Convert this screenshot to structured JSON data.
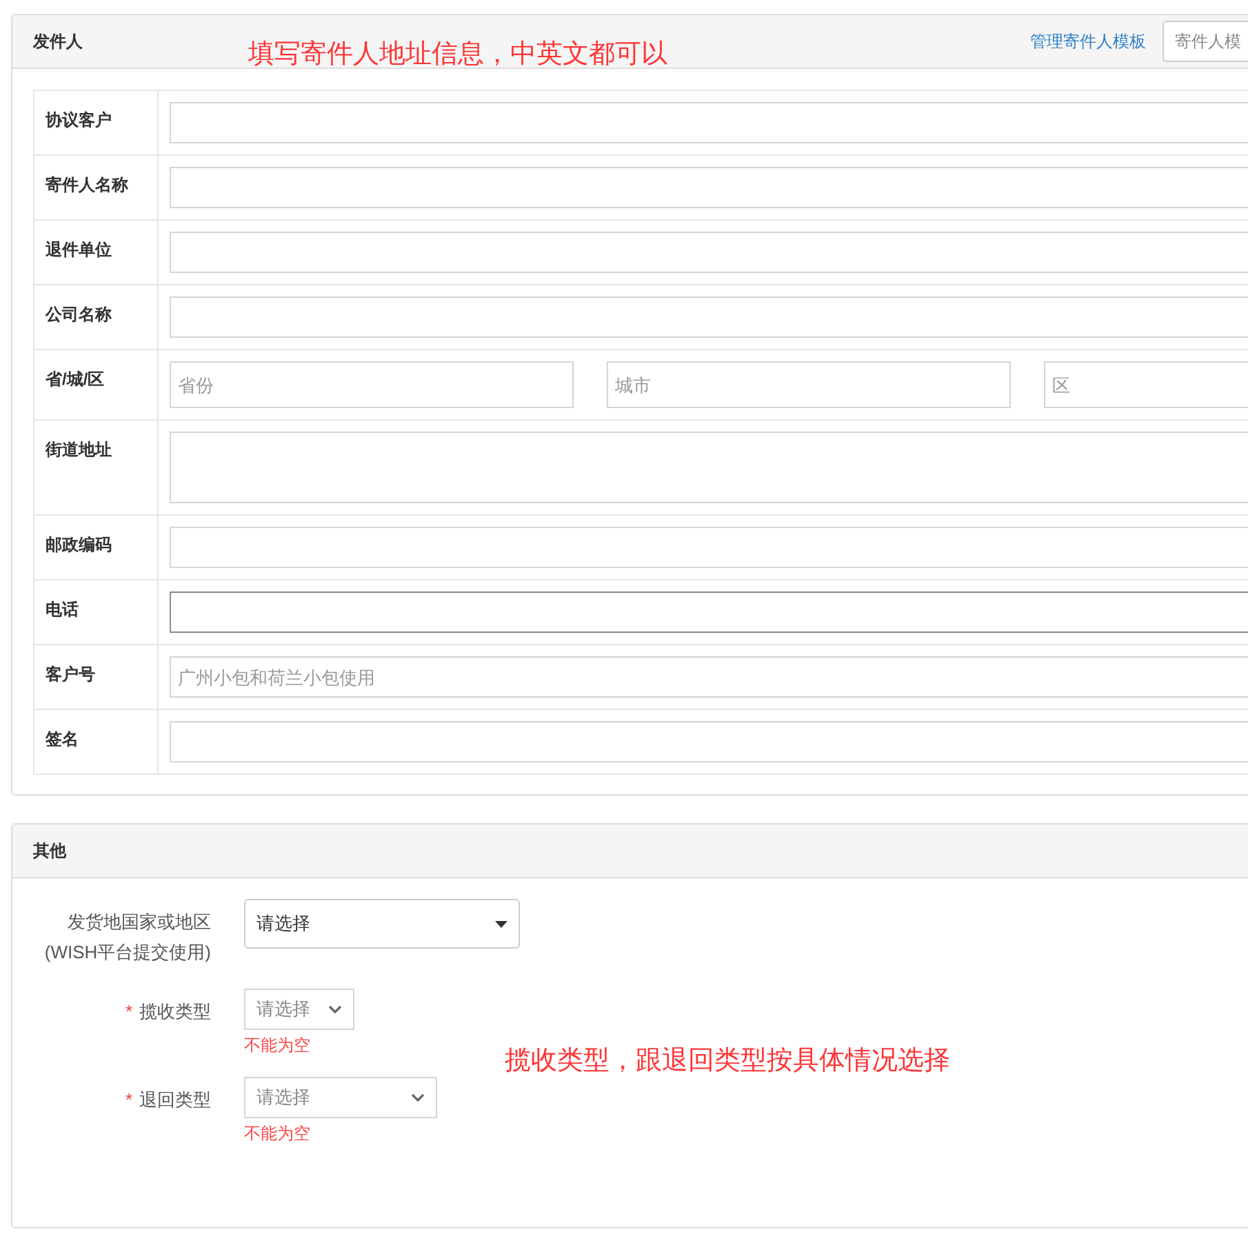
{
  "sender": {
    "title": "发件人",
    "manage_link": "管理寄件人模板",
    "template_search": {
      "placeholder": "寄件人模"
    },
    "rows": [
      {
        "kind": "text",
        "label": "协议客户",
        "focused": false
      },
      {
        "kind": "text",
        "label": "寄件人名称",
        "focused": false
      },
      {
        "kind": "text",
        "label": "退件单位",
        "focused": false
      },
      {
        "kind": "text",
        "label": "公司名称",
        "focused": false
      },
      {
        "kind": "address",
        "label": "省/城/区",
        "fields": [
          {
            "placeholder": "省份"
          },
          {
            "placeholder": "城市"
          },
          {
            "placeholder": "区"
          }
        ]
      },
      {
        "kind": "textarea",
        "label": "街道地址"
      },
      {
        "kind": "text",
        "label": "邮政编码",
        "focused": false
      },
      {
        "kind": "text",
        "label": "电话",
        "focused": true
      },
      {
        "kind": "text",
        "label": "客户号",
        "placeholder": "广州小包和荷兰小包使用",
        "focused": false
      },
      {
        "kind": "text",
        "label": "签名",
        "focused": false
      }
    ]
  },
  "other": {
    "title": "其他",
    "rows": [
      {
        "kind": "dropdown",
        "label": "发货地国家或地区",
        "sublabel": "(WISH平台提交使用)",
        "value": "请选择"
      },
      {
        "kind": "picker",
        "label": "揽收类型",
        "placeholder": "请选择",
        "required_mark": "*",
        "error": "不能为空"
      },
      {
        "kind": "select",
        "label": "退回类型",
        "placeholder": "请选择",
        "required_mark": "*",
        "error": "不能为空"
      }
    ]
  },
  "annotations": [
    {
      "text": "填写寄件人地址信息，中英文都可以"
    },
    {
      "text": "揽收类型，跟退回类型按具体情况选择"
    }
  ]
}
